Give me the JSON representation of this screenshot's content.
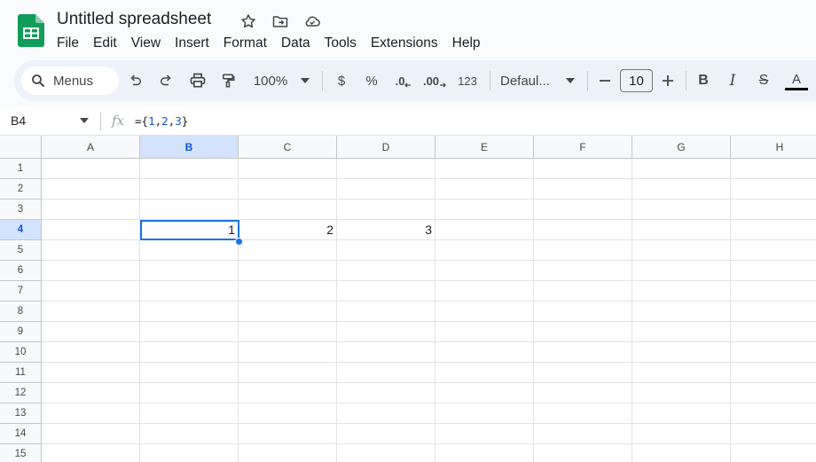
{
  "app": {
    "title": "Untitled spreadsheet",
    "accent": "#0b57d0",
    "brand": "#0f9d58"
  },
  "menu": [
    "File",
    "Edit",
    "View",
    "Insert",
    "Format",
    "Data",
    "Tools",
    "Extensions",
    "Help"
  ],
  "toolbar": {
    "menus_label": "Menus",
    "zoom": "100%",
    "currency": "$",
    "percent": "%",
    "dec_decrease": ".0",
    "dec_increase": ".00",
    "number_format": "123",
    "font": "Defaul...",
    "font_size": "10",
    "bold": "B",
    "italic": "I",
    "strike": "S",
    "text_color": "A"
  },
  "formula_bar": {
    "name_box": "B4",
    "fx": "fx",
    "formula_parts": [
      "={",
      "1",
      ",",
      "2",
      ",",
      "3",
      "}"
    ]
  },
  "grid": {
    "columns": [
      "A",
      "B",
      "C",
      "D",
      "E",
      "F",
      "G",
      "H"
    ],
    "rows": [
      "1",
      "2",
      "3",
      "4",
      "5",
      "6",
      "7",
      "8",
      "9",
      "10",
      "11",
      "12",
      "13",
      "14",
      "15"
    ],
    "selected_cell": "B4",
    "cells": {
      "B4": "1",
      "C4": "2",
      "D4": "3"
    }
  }
}
